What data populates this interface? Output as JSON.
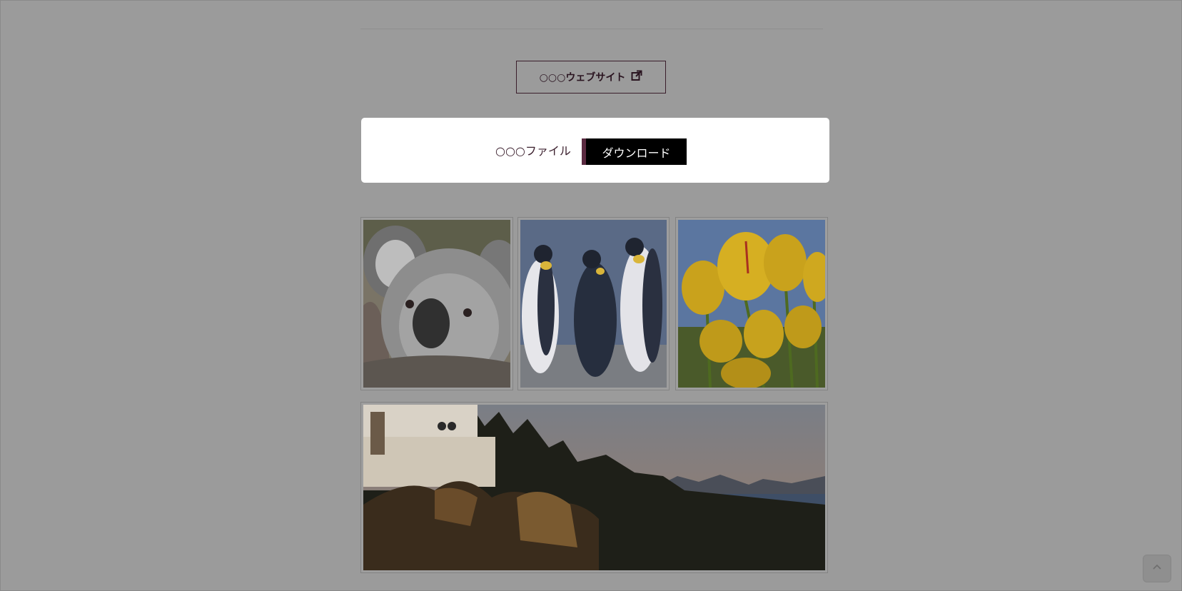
{
  "website_link": {
    "label": "○○○ウェブサイト",
    "icon": "external-link-icon"
  },
  "download": {
    "file_label": "○○○ファイル",
    "button_label": "ダウンロード"
  },
  "gallery": {
    "images": [
      {
        "subject": "koala"
      },
      {
        "subject": "penguins"
      },
      {
        "subject": "tulips"
      },
      {
        "subject": "lighthouse"
      }
    ]
  },
  "scroll_top": {
    "icon": "chevron-up-icon"
  },
  "colors": {
    "overlay_background": "#9b9b9b",
    "accent": "#5a2a40",
    "button_background": "#000000",
    "card_background": "#ffffff"
  }
}
